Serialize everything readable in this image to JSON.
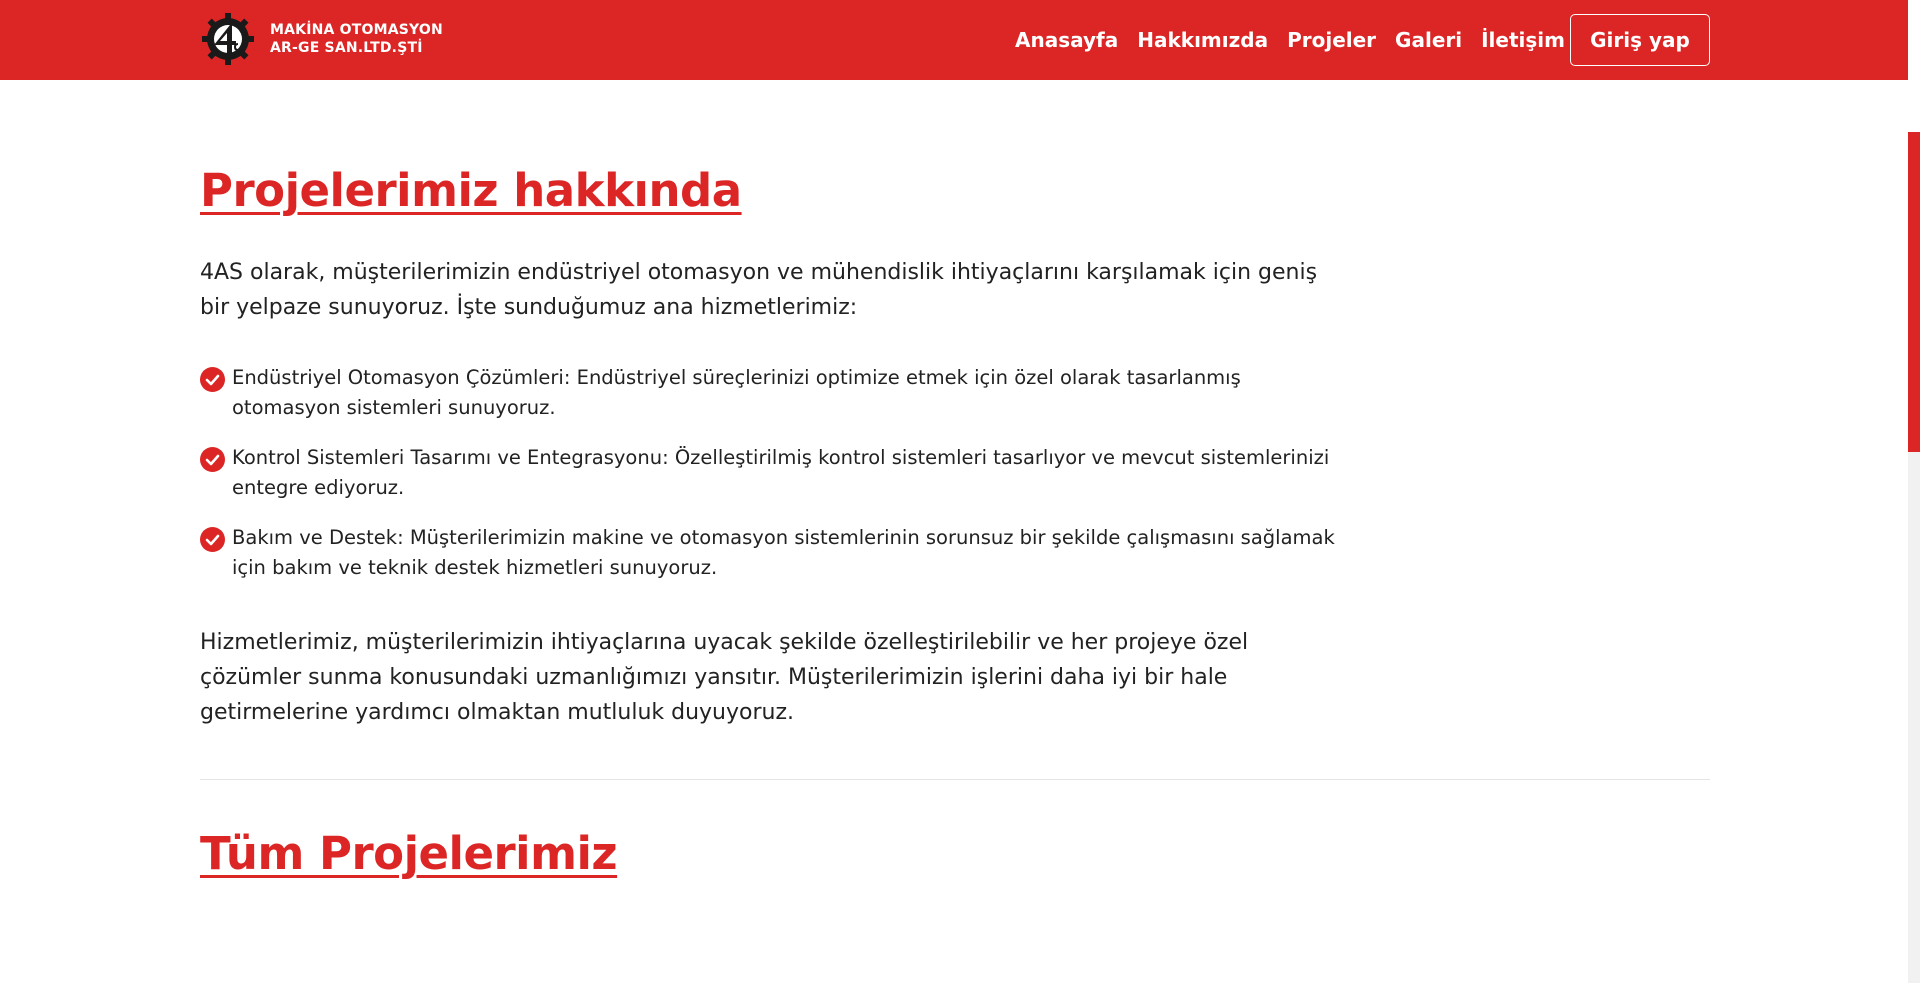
{
  "colors": {
    "brand": "#dc2626",
    "text": "#222222",
    "nav_text": "#ffffff"
  },
  "header": {
    "logo_icon": "gear-logo-icon",
    "brand_line1": "MAKİNA OTOMASYON",
    "brand_line2": "AR-GE SAN.LTD.ŞTİ",
    "nav": [
      {
        "label": "Anasayfa"
      },
      {
        "label": "Hakkımızda"
      },
      {
        "label": "Projeler"
      },
      {
        "label": "Galeri"
      },
      {
        "label": "İletişim"
      }
    ],
    "login_label": "Giriş yap"
  },
  "about": {
    "title": "Projelerimiz hakkında",
    "intro": "4AS olarak, müşterilerimizin endüstriyel otomasyon ve mühendislik ihtiyaçlarını karşılamak için geniş bir yelpaze sunuyoruz. İşte sunduğumuz ana hizmetlerimiz:",
    "services": [
      {
        "icon": "check-circle-icon",
        "text": "Endüstriyel Otomasyon Çözümleri: Endüstriyel süreçlerinizi optimize etmek için özel olarak tasarlanmış otomasyon sistemleri sunuyoruz."
      },
      {
        "icon": "check-circle-icon",
        "text": "Kontrol Sistemleri Tasarımı ve Entegrasyonu: Özelleştirilmiş kontrol sistemleri tasarlıyor ve mevcut sistemlerinizi entegre ediyoruz."
      },
      {
        "icon": "check-circle-icon",
        "text": "Bakım ve Destek: Müşterilerimizin makine ve otomasyon sistemlerinin sorunsuz bir şekilde çalışmasını sağlamak için bakım ve teknik destek hizmetleri sunuyoruz."
      }
    ],
    "closing": "Hizmetlerimiz, müşterilerimizin ihtiyaçlarına uyacak şekilde özelleştirilebilir ve her projeye özel çözümler sunma konusundaki uzmanlığımızı yansıtır. Müşterilerimizin işlerini daha iyi bir hale getirmelerine yardımcı olmaktan mutluluk duyuyoruz."
  },
  "projects": {
    "title": "Tüm Projelerimiz"
  }
}
